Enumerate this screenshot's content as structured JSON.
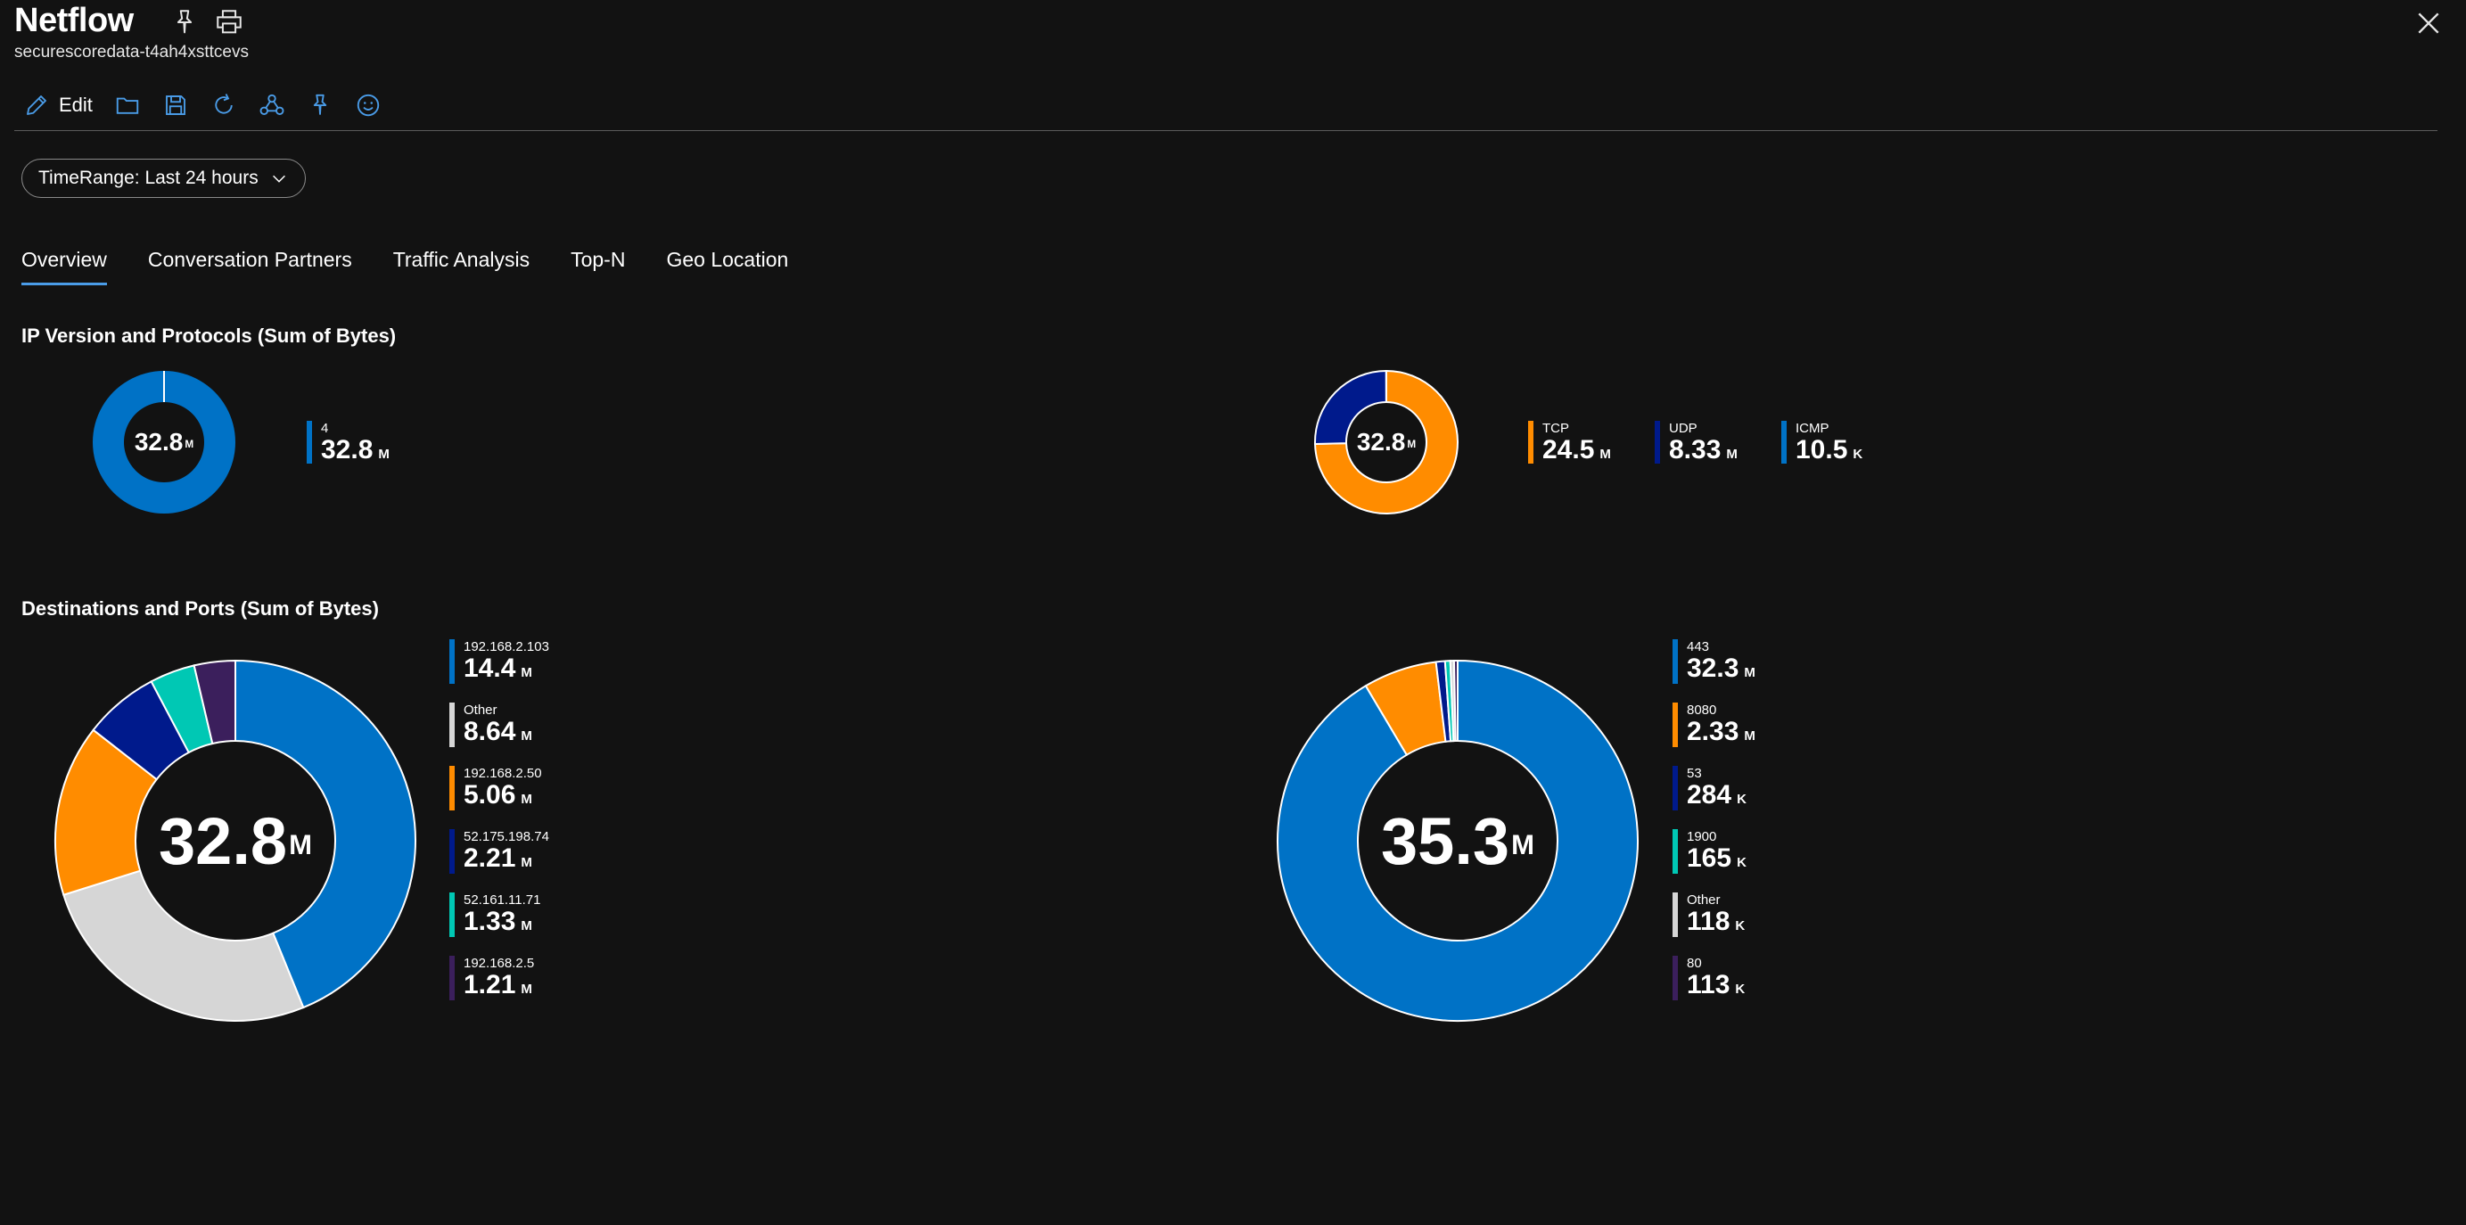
{
  "header": {
    "title": "Netflow",
    "subtitle": "securescoredata-t4ah4xsttcevs",
    "pin_icon": "pin-icon",
    "print_icon": "print-icon",
    "close_icon": "close-icon"
  },
  "toolbar": {
    "edit_label": "Edit",
    "icons": [
      "edit-icon",
      "folder-icon",
      "save-icon",
      "refresh-icon",
      "share-icon",
      "pin-icon",
      "feedback-icon"
    ]
  },
  "timerange": {
    "label": "TimeRange: Last 24 hours"
  },
  "tabs": [
    {
      "label": "Overview",
      "active": true
    },
    {
      "label": "Conversation Partners"
    },
    {
      "label": "Traffic Analysis"
    },
    {
      "label": "Top-N"
    },
    {
      "label": "Geo Location"
    }
  ],
  "sections": {
    "ip_title": "IP Version and Protocols (Sum of Bytes)",
    "dest_title": "Destinations and Ports (Sum of Bytes)"
  },
  "colors": {
    "blue": "#0072c6",
    "orange": "#ff8c00",
    "navy": "#001a8c",
    "teal": "#00c8b4",
    "gray": "#d6d6d6",
    "purple": "#3b1f5c",
    "accent": "#4a9ce8"
  },
  "chart_data": [
    {
      "type": "pie",
      "title": "IP Version and Protocols (Sum of Bytes)",
      "center_value": "32.8",
      "center_unit": "M",
      "series": [
        {
          "name": "4",
          "value": 32.8,
          "display": "32.8",
          "unit": "M",
          "color": "#0072c6"
        }
      ]
    },
    {
      "type": "pie",
      "center_value": "32.8",
      "center_unit": "M",
      "series": [
        {
          "name": "TCP",
          "value": 24.5,
          "display": "24.5",
          "unit": "M",
          "color": "#ff8c00"
        },
        {
          "name": "UDP",
          "value": 8.33,
          "display": "8.33",
          "unit": "M",
          "color": "#001a8c"
        },
        {
          "name": "ICMP",
          "value": 0.0105,
          "display": "10.5",
          "unit": "K",
          "color": "#0072c6"
        }
      ]
    },
    {
      "type": "pie",
      "title": "Destinations and Ports (Sum of Bytes)",
      "center_value": "32.8",
      "center_unit": "M",
      "series": [
        {
          "name": "192.168.2.103",
          "value": 14.4,
          "display": "14.4",
          "unit": "M",
          "color": "#0072c6"
        },
        {
          "name": "Other",
          "value": 8.64,
          "display": "8.64",
          "unit": "M",
          "color": "#d6d6d6"
        },
        {
          "name": "192.168.2.50",
          "value": 5.06,
          "display": "5.06",
          "unit": "M",
          "color": "#ff8c00"
        },
        {
          "name": "52.175.198.74",
          "value": 2.21,
          "display": "2.21",
          "unit": "M",
          "color": "#001a8c"
        },
        {
          "name": "52.161.11.71",
          "value": 1.33,
          "display": "1.33",
          "unit": "M",
          "color": "#00c8b4"
        },
        {
          "name": "192.168.2.5",
          "value": 1.21,
          "display": "1.21",
          "unit": "M",
          "color": "#3b1f5c"
        }
      ]
    },
    {
      "type": "pie",
      "center_value": "35.3",
      "center_unit": "M",
      "series": [
        {
          "name": "443",
          "value": 32.3,
          "display": "32.3",
          "unit": "M",
          "color": "#0072c6"
        },
        {
          "name": "8080",
          "value": 2.33,
          "display": "2.33",
          "unit": "M",
          "color": "#ff8c00"
        },
        {
          "name": "53",
          "value": 0.284,
          "display": "284",
          "unit": "K",
          "color": "#001a8c"
        },
        {
          "name": "1900",
          "value": 0.165,
          "display": "165",
          "unit": "K",
          "color": "#00c8b4"
        },
        {
          "name": "Other",
          "value": 0.118,
          "display": "118",
          "unit": "K",
          "color": "#d6d6d6"
        },
        {
          "name": "80",
          "value": 0.113,
          "display": "113",
          "unit": "K",
          "color": "#3b1f5c"
        }
      ]
    }
  ]
}
